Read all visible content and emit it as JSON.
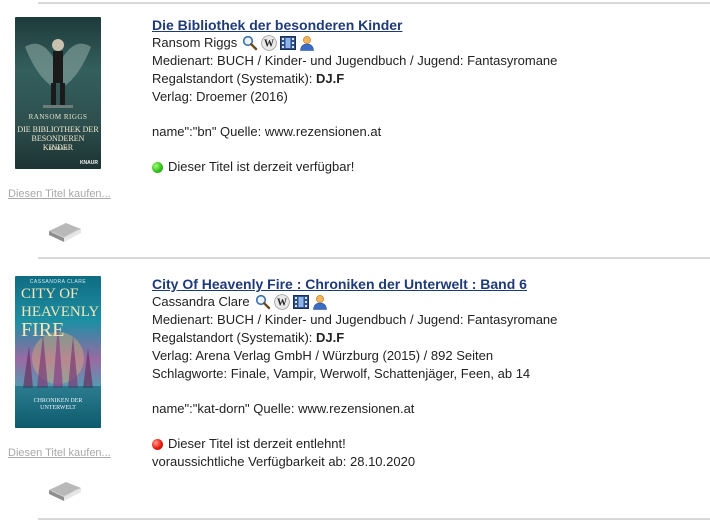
{
  "results": [
    {
      "cover": {
        "author": "RANSOM RIGGS",
        "title_line1": "DIE BIBLIOTHEK DER",
        "title_line2": "BESONDEREN KINDER",
        "genre": "ROMAN",
        "publisher": "KNAUR"
      },
      "buy_link": "Diesen Titel kaufen...",
      "title": "Die Bibliothek der besonderen Kinder",
      "author": "Ransom Riggs",
      "icons": [
        "search-icon",
        "wikipedia-icon",
        "film-icon",
        "person-icon"
      ],
      "medienart": "Medienart: BUCH / Kinder- und Jugendbuch / Jugend: Fantasyromane",
      "regal_label": "Regalstandort (Systematik): ",
      "regal_value": "DJ.F",
      "verlag": "Verlag: Droemer (2016)",
      "source": "name\":\"bn\" Quelle: www.rezensionen.at",
      "status": "Dieser Titel ist derzeit verfügbar!",
      "status_color": "#34c21b"
    },
    {
      "cover": {
        "author": "CASSANDRA CLARE",
        "title_line1": "CITY OF HEAVENLY",
        "title_line2": "FIRE",
        "subtitle_line1": "CHRONIKEN DER",
        "subtitle_line2": "UNTERWELT"
      },
      "buy_link": "Diesen Titel kaufen...",
      "title": "City Of Heavenly Fire : Chroniken der Unterwelt : Band 6",
      "author": "Cassandra Clare",
      "icons": [
        "search-icon",
        "wikipedia-icon",
        "film-icon",
        "person-icon"
      ],
      "medienart": "Medienart: BUCH / Kinder- und Jugendbuch / Jugend: Fantasyromane",
      "regal_label": "Regalstandort (Systematik): ",
      "regal_value": "DJ.F",
      "verlag": "Verlag: Arena Verlag GmbH / Würzburg (2015) / 892 Seiten",
      "schlagworte": "Schlagworte: Finale, Vampir, Werwolf, Schattenjäger, Feen, ab 14",
      "source": "name\":\"kat-dorn\" Quelle: www.rezensionen.at",
      "status": "Dieser Titel ist derzeit entlehnt!",
      "status_color": "#e81a0e",
      "availability": "voraussichtliche Verfügbarkeit ab: 28.10.2020"
    }
  ]
}
